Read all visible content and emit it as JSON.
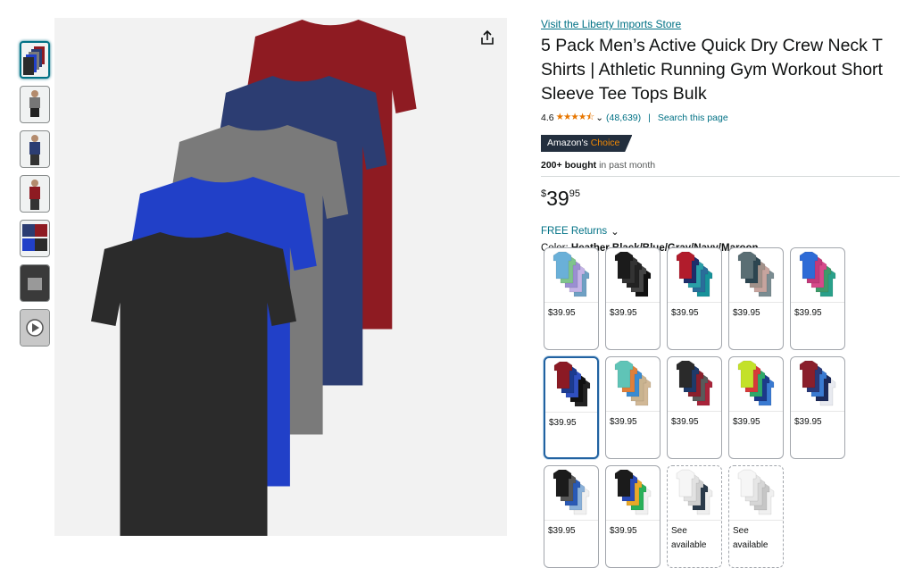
{
  "store_link": "Visit the Liberty Imports Store",
  "title": "5 Pack Men’s Active Quick Dry Crew Neck T Shirts | Athletic Running Gym Workout Short Sleeve Tee Tops Bulk",
  "rating": {
    "value": "4.6",
    "stars": 4.5,
    "count": "(48,639)",
    "search": "Search this page"
  },
  "badge": {
    "prefix": "Amazon's",
    "suffix": "Choice"
  },
  "bought": {
    "strong": "200+ bought",
    "rest": "in past month"
  },
  "price": {
    "symbol": "$",
    "whole": "39",
    "fraction": "95"
  },
  "returns": "FREE Returns",
  "color": {
    "label": "Color:",
    "value": "Heather Black/Blue/Gray/Navy/Maroon"
  },
  "swatches": [
    {
      "price": "$39.95",
      "colors": [
        "#6ab0d8",
        "#7fc48c",
        "#9a8fd1",
        "#c4b3e6",
        "#6fa0c4"
      ]
    },
    {
      "price": "$39.95",
      "colors": [
        "#1b1b1b",
        "#333",
        "#222",
        "#444",
        "#111"
      ]
    },
    {
      "price": "$39.95",
      "colors": [
        "#b11c2c",
        "#1e2d6b",
        "#2a9fa8",
        "#2a6d9a",
        "#17929a"
      ]
    },
    {
      "price": "$39.95",
      "colors": [
        "#5a6e74",
        "#2c4550",
        "#a2918a",
        "#c7a49e",
        "#7a8c91"
      ]
    },
    {
      "price": "$39.95",
      "colors": [
        "#2e6bd6",
        "#c23a7a",
        "#d64a8a",
        "#3e9a6a",
        "#2aa08a"
      ]
    },
    {
      "price": "$39.95",
      "colors": [
        "#8b1a24",
        "#1c3b8f",
        "#3050c0",
        "#111",
        "#222"
      ]
    },
    {
      "price": "$39.95",
      "colors": [
        "#5fc4b7",
        "#e07f3a",
        "#3a8bd1",
        "#c9b38f",
        "#d1b896"
      ]
    },
    {
      "price": "$39.95",
      "colors": [
        "#2a2a2a",
        "#1e3a6a",
        "#8a1f2c",
        "#5a5a5a",
        "#a8243a"
      ]
    },
    {
      "price": "$39.95",
      "colors": [
        "#c3e12a",
        "#d63a3a",
        "#2fa86a",
        "#1c3a8a",
        "#3a7ad1"
      ]
    },
    {
      "price": "$39.95",
      "colors": [
        "#8a1f2c",
        "#2a3a7a",
        "#3a7ad1",
        "#1c2a5a",
        "#e8eaf0"
      ]
    },
    {
      "price": "$39.95",
      "colors": [
        "#1b1b1b",
        "#555",
        "#2a5ab5",
        "#8ab0d8",
        "#f0f0f0"
      ]
    },
    {
      "price": "$39.95",
      "colors": [
        "#1b1b1b",
        "#2a4ab5",
        "#e8a82a",
        "#2ab05a",
        "#f0f0f0"
      ]
    },
    {
      "price": "See available",
      "colors": [
        "#f6f6f6",
        "#e2e2e2",
        "#cfcfcf",
        "#2a3a4a",
        "#eeeeee"
      ]
    },
    {
      "price": "See available",
      "colors": [
        "#f6f6f6",
        "#e6e6e6",
        "#d6d6d6",
        "#c6c6c6",
        "#f0f0f0"
      ]
    }
  ],
  "main_shirts": [
    "#8e1b22",
    "#2c3d72",
    "#7a7a7a",
    "#2140c8",
    "#2b2b2b"
  ]
}
